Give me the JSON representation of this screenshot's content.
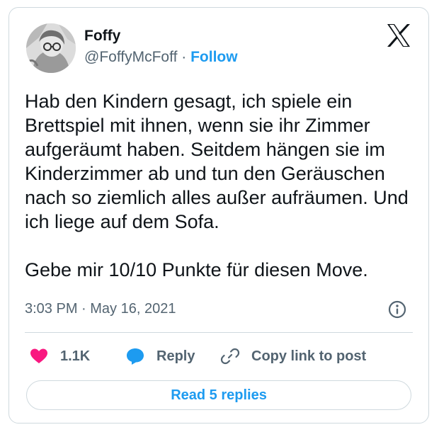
{
  "author": {
    "name": "Foffy",
    "handle": "@FoffyMcFoff",
    "separator": "·",
    "follow_label": "Follow"
  },
  "tweet": {
    "text": "Hab den Kindern gesagt, ich spiele ein Brettspiel mit ihnen, wenn sie ihr Zimmer aufgeräumt haben. Seitdem hängen sie im Kinderzimmer ab und tun den Geräuschen nach so ziemlich alles außer aufräumen. Und ich liege auf dem Sofa.\n\nGebe mir 10/10 Punkte für diesen Move.",
    "timestamp": "3:03 PM · May 16, 2021"
  },
  "actions": {
    "like_count": "1.1K",
    "reply_label": "Reply",
    "copy_label": "Copy link to post"
  },
  "footer": {
    "read_replies_label": "Read 5 replies"
  },
  "colors": {
    "accent": "#1d9bf0",
    "like": "#f91880",
    "secondary_text": "#536471",
    "border": "#cfd9de"
  },
  "icons": {
    "platform": "x-logo-icon",
    "info": "info-icon",
    "like": "heart-icon",
    "reply": "speech-bubble-icon",
    "copy": "link-icon"
  }
}
